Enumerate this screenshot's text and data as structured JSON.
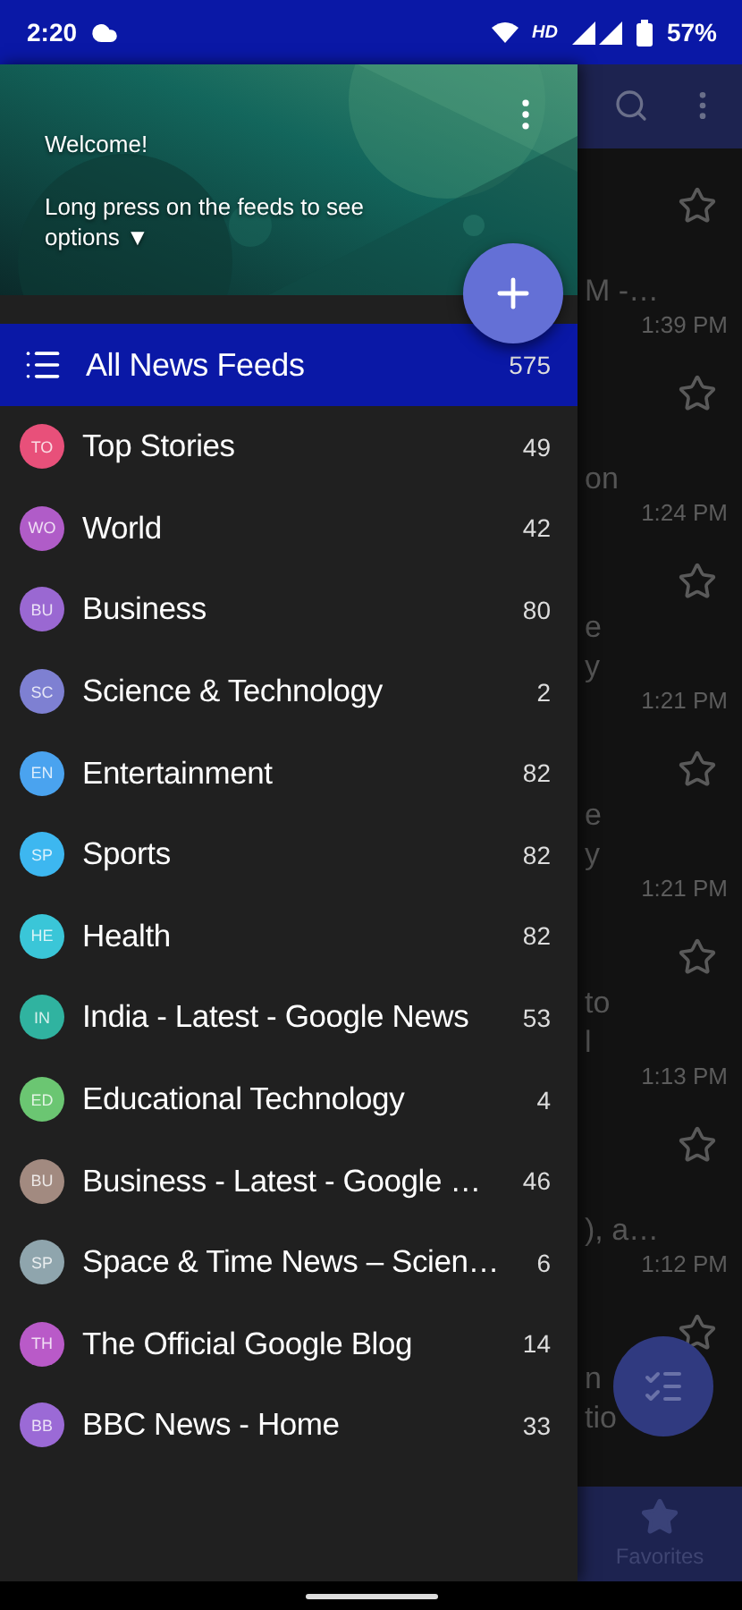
{
  "status_bar": {
    "time": "2:20",
    "network": "HD",
    "battery": "57%"
  },
  "drawer": {
    "header": {
      "welcome": "Welcome!",
      "hint": "Long press on the feeds to see options ▼"
    },
    "feeds": [
      {
        "kind": "all",
        "name": "All News Feeds",
        "count": "575",
        "selected": true
      },
      {
        "kind": "feed",
        "badge": "TO",
        "name": "Top Stories",
        "count": "49",
        "selected": false,
        "color": "#e8507a"
      },
      {
        "kind": "feed",
        "badge": "WO",
        "name": "World",
        "count": "42",
        "selected": false,
        "color": "#b05cc8"
      },
      {
        "kind": "feed",
        "badge": "BU",
        "name": "Business",
        "count": "80",
        "selected": false,
        "color": "#9a68d2"
      },
      {
        "kind": "feed",
        "badge": "SC",
        "name": "Science & Technology",
        "count": "2",
        "selected": false,
        "color": "#7e80d2"
      },
      {
        "kind": "feed",
        "badge": "EN",
        "name": "Entertainment",
        "count": "82",
        "selected": false,
        "color": "#4aa3ef"
      },
      {
        "kind": "feed",
        "badge": "SP",
        "name": "Sports",
        "count": "82",
        "selected": false,
        "color": "#3db7f0"
      },
      {
        "kind": "feed",
        "badge": "HE",
        "name": "Health",
        "count": "82",
        "selected": false,
        "color": "#3ac6d8"
      },
      {
        "kind": "feed",
        "badge": "IN",
        "name": "India - Latest - Google News",
        "count": "53",
        "selected": false,
        "color": "#30b3a0"
      },
      {
        "kind": "feed",
        "badge": "ED",
        "name": "Educational Technology",
        "count": "4",
        "selected": false,
        "color": "#6bc672"
      },
      {
        "kind": "feed",
        "badge": "BU",
        "name": "Business - Latest - Google …",
        "count": "46",
        "selected": false,
        "color": "#a28a80"
      },
      {
        "kind": "feed",
        "badge": "SP",
        "name": "Space & Time News – Scien…",
        "count": "6",
        "selected": false,
        "color": "#8fa5ad"
      },
      {
        "kind": "feed",
        "badge": "TH",
        "name": "The Official Google Blog",
        "count": "14",
        "selected": false,
        "color": "#b95ac8"
      },
      {
        "kind": "feed",
        "badge": "BB",
        "name": "BBC News - Home",
        "count": "33",
        "selected": false,
        "color": "#9b6ad6"
      }
    ]
  },
  "background": {
    "articles": [
      {
        "lines": [
          "M -…"
        ],
        "time": "1:39 PM"
      },
      {
        "lines": [
          "on"
        ],
        "time": "1:24 PM"
      },
      {
        "lines": [
          "e",
          "y"
        ],
        "time": "1:21 PM"
      },
      {
        "lines": [
          "e",
          "y"
        ],
        "time": "1:21 PM"
      },
      {
        "lines": [
          "to",
          "l"
        ],
        "time": "1:13 PM"
      },
      {
        "lines": [
          "), a…"
        ],
        "time": "1:12 PM"
      },
      {
        "lines": [
          "n",
          "tio"
        ]
      }
    ],
    "bottom_nav": {
      "label": "Favorites"
    }
  }
}
